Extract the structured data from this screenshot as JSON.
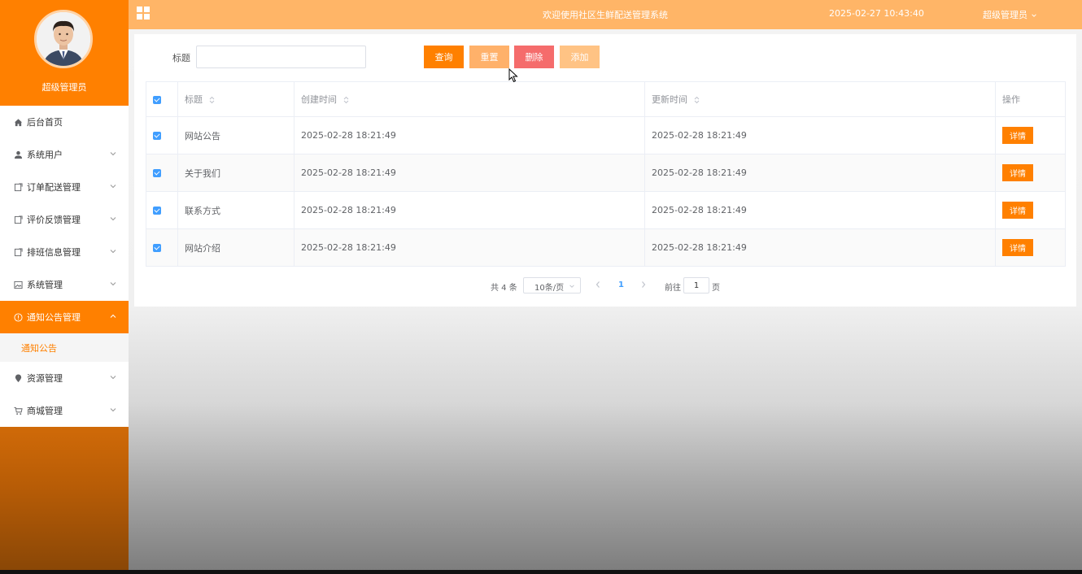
{
  "sidebar": {
    "profile_name": "超级管理员",
    "items": [
      {
        "label": "后台首页",
        "icon": "home-icon"
      },
      {
        "label": "系统用户",
        "icon": "user-icon"
      },
      {
        "label": "订单配送管理",
        "icon": "doc-icon"
      },
      {
        "label": "评价反馈管理",
        "icon": "doc-icon"
      },
      {
        "label": "排班信息管理",
        "icon": "doc-icon"
      },
      {
        "label": "系统管理",
        "icon": "picture-icon"
      },
      {
        "label": "通知公告管理",
        "icon": "info-icon"
      },
      {
        "label": "资源管理",
        "icon": "location-icon"
      },
      {
        "label": "商城管理",
        "icon": "cart-icon"
      }
    ],
    "submenu": {
      "label": "通知公告"
    }
  },
  "topbar": {
    "title": "欢迎使用社区生鲜配送管理系统",
    "datetime": "2025-02-27 10:43:40",
    "user": "超级管理员"
  },
  "search": {
    "label": "标题",
    "value": "",
    "buttons": {
      "query": "查询",
      "reset": "重置",
      "delete": "删除",
      "add": "添加"
    }
  },
  "table": {
    "headers": {
      "title": "标题",
      "created": "创建时间",
      "updated": "更新时间",
      "action": "操作"
    },
    "rows": [
      {
        "title": "网站公告",
        "created": "2025-02-28 18:21:49",
        "updated": "2025-02-28 18:21:49",
        "action": "详情"
      },
      {
        "title": "关于我们",
        "created": "2025-02-28 18:21:49",
        "updated": "2025-02-28 18:21:49",
        "action": "详情"
      },
      {
        "title": "联系方式",
        "created": "2025-02-28 18:21:49",
        "updated": "2025-02-28 18:21:49",
        "action": "详情"
      },
      {
        "title": "网站介绍",
        "created": "2025-02-28 18:21:49",
        "updated": "2025-02-28 18:21:49",
        "action": "详情"
      }
    ]
  },
  "pagination": {
    "total": "共 4 条",
    "page_size": "10条/页",
    "current": "1",
    "goto_label": "前往",
    "goto_value": "1",
    "page_suffix": "页"
  },
  "colors": {
    "primary": "#ff8000",
    "topbar": "#ffb567",
    "danger": "#f56c6c",
    "checkbox": "#409eff"
  }
}
